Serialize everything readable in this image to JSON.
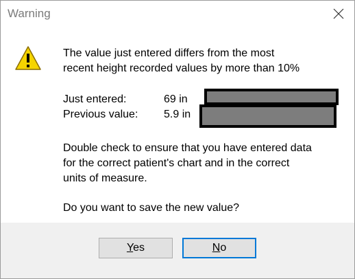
{
  "window": {
    "title": "Warning"
  },
  "icons": {
    "warning": "warning-triangle-icon",
    "close": "close-icon"
  },
  "message": {
    "line1": "The value just entered differs from the most",
    "line2": "recent height recorded values by more than 10%",
    "just_entered_label": "Just entered:",
    "just_entered_value": "69 in",
    "previous_label": "Previous value:",
    "previous_value": "5.9 in",
    "advice_line1": "Double check to ensure that you have entered data",
    "advice_line2": "for the correct patient's chart and in the correct",
    "advice_line3": "units of measure.",
    "question": "Do you want to save the new value?"
  },
  "buttons": {
    "yes_mnemonic": "Y",
    "yes_rest": "es",
    "no_mnemonic": "N",
    "no_rest": "o"
  },
  "colors": {
    "accent": "#0078d7",
    "warning_fill": "#f5d400",
    "footer_bg": "#f0f0f0",
    "redaction": "#7d7d7d"
  }
}
